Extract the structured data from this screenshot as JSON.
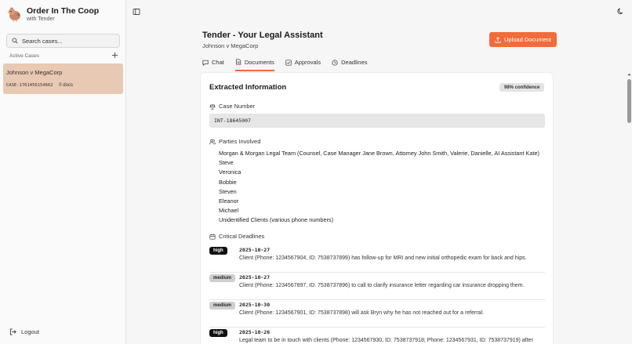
{
  "sidebar": {
    "brand_title": "Order In The Coop",
    "brand_sub": "with Tender",
    "search_placeholder": "Search cases...",
    "active_cases_label": "Active Cases",
    "cases": [
      {
        "title": "Johnson v MegaCorp",
        "id": "CASE-1761456154662",
        "docs": "0 docs"
      }
    ],
    "logout_label": "Logout"
  },
  "header": {
    "title": "Tender - Your Legal Assistant",
    "subtitle": "Johnson v MegaCorp",
    "upload_label": "Upload Document"
  },
  "tabs": [
    {
      "label": "Chat",
      "icon": "chat-icon"
    },
    {
      "label": "Documents",
      "icon": "document-icon",
      "active": true
    },
    {
      "label": "Approvals",
      "icon": "checkbox-icon"
    },
    {
      "label": "Deadlines",
      "icon": "clock-icon"
    }
  ],
  "extracted": {
    "heading": "Extracted Information",
    "confidence": "98% confidence",
    "case_number_label": "Case Number",
    "case_number": "INT-18645007",
    "parties_label": "Parties Involved",
    "parties": [
      "Morgan & Morgan Legal Team (Counsel, Case Manager Jane Brown, Attorney John Smith, Valerie, Danielle, AI Assistant Kate)",
      "Steve",
      "Veronica",
      "Bobbie",
      "Steven",
      "Eleanor",
      "Michael",
      "Unidentified Clients (various phone numbers)"
    ],
    "deadlines_label": "Critical Deadlines",
    "deadlines": [
      {
        "priority": "high",
        "date": "2025-10-27",
        "description": "Client (Phone: 1234567904, ID: 7538737899) has follow-up for MRI and new initial orthopedic exam for back and hips."
      },
      {
        "priority": "medium",
        "date": "2025-10-27",
        "description": "Client (Phone: 1234567897, ID: 7538737896) to call to clarify insurance letter regarding car insurance dropping them."
      },
      {
        "priority": "medium",
        "date": "2025-10-30",
        "description": "Client (Phone: 1234567901, ID: 7538737898) will ask Bryn why he has not reached out for a referral."
      },
      {
        "priority": "high",
        "date": "2025-10-26",
        "description": "Legal team to be in touch with clients (Phone: 1234567930, ID: 7538737918; Phone: 1234567931, ID: 7538737919) after"
      }
    ]
  },
  "colors": {
    "accent": "#f26b3a",
    "selected_case": "#e8c9b4",
    "high_pill": "#111111",
    "medium_pill": "#cfcfcf"
  }
}
